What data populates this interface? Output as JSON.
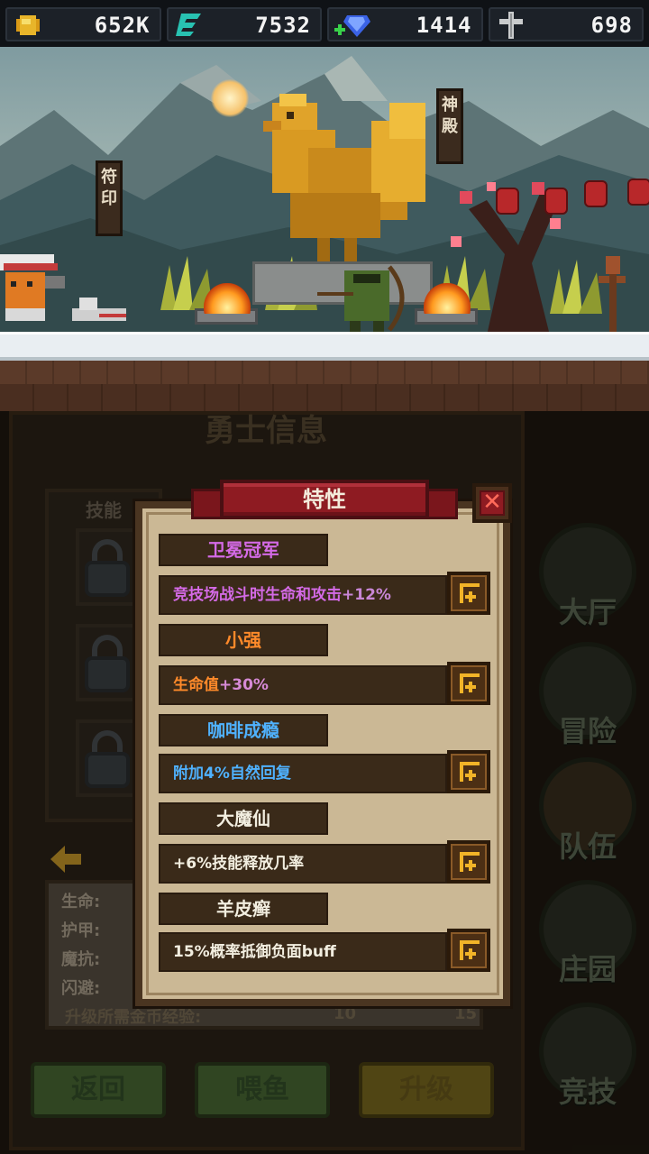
{
  "resources": [
    {
      "icon": "gold-nugget-icon",
      "value": "652K"
    },
    {
      "icon": "energy-e-icon",
      "value": "7532"
    },
    {
      "icon": "diamond-plus-icon",
      "value": "1414"
    },
    {
      "icon": "cross-sword-icon",
      "value": "698"
    }
  ],
  "scene": {
    "sign_left": "符印",
    "sign_right": "神殿"
  },
  "hero_panel": {
    "title": "勇士信息",
    "skill_label": "技能",
    "stats": [
      "生命:",
      "护甲:",
      "魔抗:",
      "闪避:"
    ],
    "upgrade_label": "升级所需金币经验:",
    "upgrade_exp": "10",
    "upgrade_gold": "15"
  },
  "bottom_buttons": {
    "back": "返回",
    "feed": "喂鱼",
    "upgrade": "升级"
  },
  "side_nav": [
    {
      "label": "大厅",
      "icon": "hall-icon"
    },
    {
      "label": "冒险",
      "icon": "adventure-icon"
    },
    {
      "label": "队伍",
      "icon": "team-icon"
    },
    {
      "label": "庄园",
      "icon": "manor-icon"
    },
    {
      "label": "竞技",
      "icon": "arena-swords-icon"
    }
  ],
  "modal": {
    "title": "特性",
    "traits": [
      {
        "name": "卫冕冠军",
        "name_color": "#d46ae6",
        "desc": "竞技场战斗时生命和攻击",
        "bonus": "+12%",
        "desc_color": "#d46ae6"
      },
      {
        "name": "小强",
        "name_color": "#ff8a2a",
        "desc": "生命值",
        "bonus": "+30%",
        "desc_color": "#ff8a2a"
      },
      {
        "name": "咖啡成瘾",
        "name_color": "#4fb2ff",
        "desc": "附加4%自然回复",
        "bonus": "",
        "desc_color": "#4fb2ff"
      },
      {
        "name": "大魔仙",
        "name_color": "#f2eee0",
        "desc": "+6%技能释放几率",
        "bonus": "",
        "desc_color": "#f2eee0"
      },
      {
        "name": "羊皮癣",
        "name_color": "#f2eee0",
        "desc": "15%概率抵御负面buff",
        "bonus": "",
        "desc_color": "#f2eee0"
      }
    ]
  },
  "colors": {
    "ribbon": "#8e1b22",
    "plus_accent": "#f2b428",
    "parchment": "#cbb895"
  }
}
